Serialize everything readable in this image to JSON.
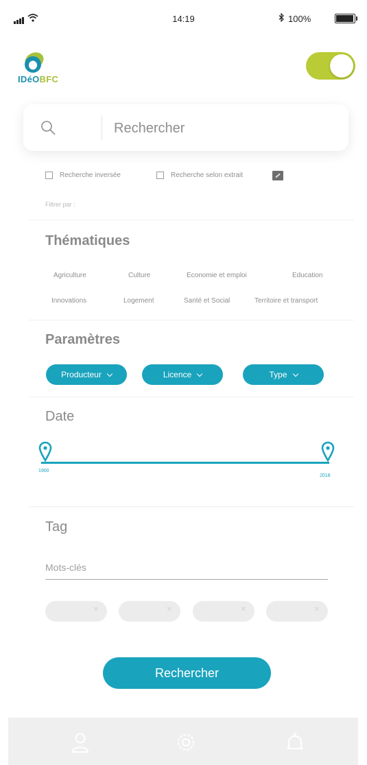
{
  "status_bar": {
    "time": "14:19",
    "battery": "100%"
  },
  "logo": {
    "text_part1": "IDéO",
    "text_part2": "BFC"
  },
  "search": {
    "placeholder": "Rechercher"
  },
  "options": {
    "reverse_search": "Recherche inversée",
    "extract_search": "Recherche selon extrait"
  },
  "filter": {
    "label": "Filtrer par :"
  },
  "thematiques": {
    "title": "Thématiques",
    "items": [
      "Agriculture",
      "Culture",
      "Economie et emploi",
      "Education",
      "Innovations",
      "Logement",
      "Santé et Social",
      "Territoire et transport"
    ]
  },
  "parametres": {
    "title": "Paramètres",
    "filters": [
      "Producteur",
      "Licence",
      "Type"
    ]
  },
  "date": {
    "title": "Date",
    "start_label": "1900",
    "end_label": "2018",
    "range_start_fraction": 0.0,
    "range_end_fraction": 1.0
  },
  "tag": {
    "title": "Tag",
    "placeholder": "Mots-clés",
    "chips": [
      "",
      "",
      "",
      ""
    ]
  },
  "actions": {
    "search_button": "Rechercher"
  },
  "nav": {
    "icons": [
      "user-icon",
      "settings-icon",
      "bell-icon"
    ]
  },
  "colors": {
    "accent": "#1aa3bd",
    "toggle": "#b9cb35",
    "logo_blue": "#1a90b0",
    "logo_green": "#a6c13b"
  }
}
